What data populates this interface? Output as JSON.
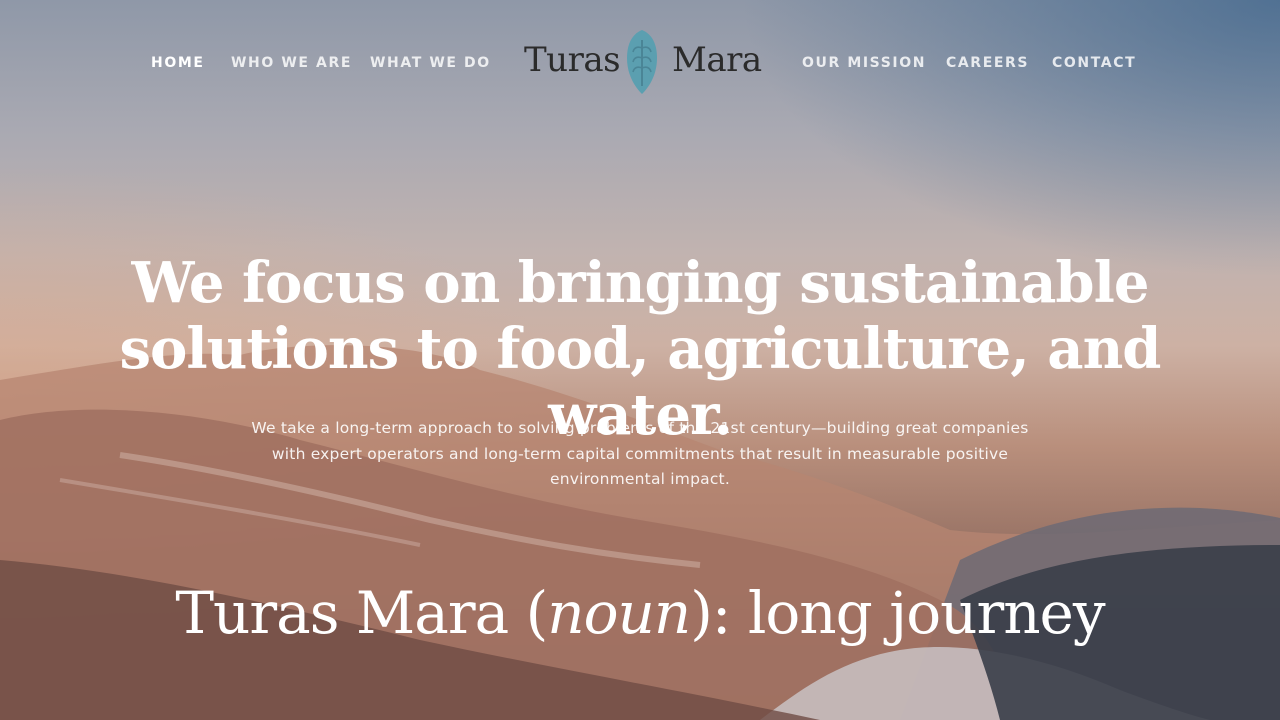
{
  "nav": {
    "left_items": [
      {
        "label": "HOME",
        "active": true
      },
      {
        "label": "WHO WE ARE",
        "active": false
      },
      {
        "label": "WHAT WE DO",
        "active": false
      }
    ],
    "right_items": [
      {
        "label": "OUR MISSION",
        "active": false
      },
      {
        "label": "CAREERS",
        "active": false
      },
      {
        "label": "CONTACT",
        "active": false
      }
    ]
  },
  "logo": {
    "word_left": "Turas",
    "word_right": "Mara",
    "icon": "wheat-leaf-icon",
    "icon_color": "#5b9fb0",
    "text_color": "#2b2b2b"
  },
  "hero": {
    "headline": "We focus on bringing sustainable solutions to food, agriculture, and water.",
    "subtext": "We take a long-term approach to solving problems of the 21st century—building great companies with expert operators and long-term capital commitments that result in measurable positive environmental impact.",
    "tagline_before": "Turas Mara (",
    "tagline_pos": "noun",
    "tagline_after": "): long journey",
    "background": "mountain-lake-landscape-image"
  }
}
